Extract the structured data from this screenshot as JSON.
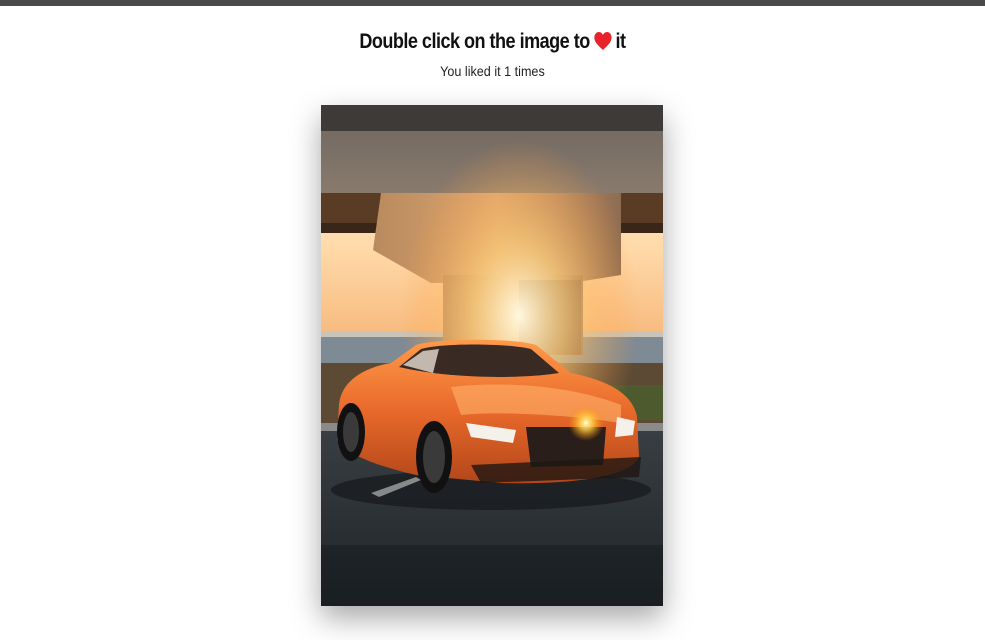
{
  "header": {
    "title_before": "Double click on the image to",
    "title_after": "it",
    "heart_icon": "heart-icon",
    "heart_color": "#e8212b",
    "like_text_prefix": "You liked it",
    "like_count": "1",
    "like_text_suffix": "times"
  },
  "image": {
    "subject": "orange-coupe-under-bridge-at-sunset"
  },
  "colors": {
    "top_bar": "#4a4a4c"
  }
}
